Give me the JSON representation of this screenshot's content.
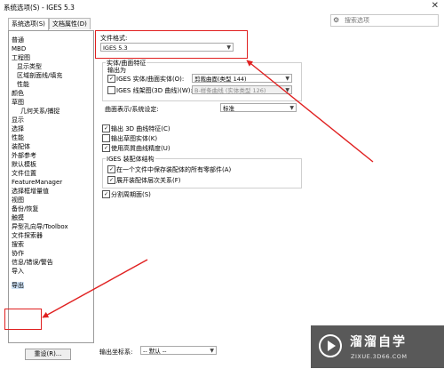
{
  "window": {
    "title": "系统选项(S) - IGES 5.3",
    "close_glyph": "✕"
  },
  "tabs": [
    {
      "label": "系统选项(S)"
    },
    {
      "label": "文档属性(D)"
    }
  ],
  "search": {
    "placeholder": "搜索选项"
  },
  "tree": {
    "items": [
      "普通",
      "MBD",
      "工程图",
      "显示类型",
      "区域剖面线/填充",
      "性能",
      "颜色",
      "草图",
      "几何关系/捕捉",
      "显示",
      "选择",
      "性能",
      "装配体",
      "外部参考",
      "默认模板",
      "文件位置",
      "FeatureManager",
      "选择框增量值",
      "视图",
      "备份/恢复",
      "触摸",
      "异型孔向导/Toolbox",
      "文件探索器",
      "搜索",
      "协作",
      "信息/错误/警告",
      "导入",
      "导出"
    ]
  },
  "file_format": {
    "label": "文件格式:",
    "value": "IGES 5.3"
  },
  "solid_surface": {
    "group_label": "实体/曲面特征",
    "output_as_label": "输出为",
    "iges_solid_label": "IGES 实体/曲面实体(O):",
    "iges_solid_value": "剪裁曲面(类型 144)",
    "wireframe_label": "IGES 线架图(3D 曲线)(W):",
    "wireframe_value": "B-样条曲线 (实体类型 126)"
  },
  "surface_rep": {
    "label": "曲面表示/系统设定:",
    "value": "标准"
  },
  "options": {
    "output_3d": "输出 3D 曲线特征(C)",
    "output_sketch": "输出草图实体(K)",
    "high_precision": "使用高質曲线精度(U)"
  },
  "assembly": {
    "group_label": "IGES 装配体结构",
    "save_all": "在一个文件中保存装配体的所有零部件(A)",
    "flatten": "展开装配体层次关系(F)"
  },
  "split_periodic": "分割周期面(S)",
  "reset_button": "重设(R)...",
  "coord": {
    "label": "输出坐标系:",
    "value": "-- 默认 --"
  },
  "watermark": {
    "brand": "溜溜自学",
    "url": "ZIXUE.3D66.COM"
  },
  "colors": {
    "annotation_red": "#e02020",
    "selection": "#cfe3f7"
  }
}
